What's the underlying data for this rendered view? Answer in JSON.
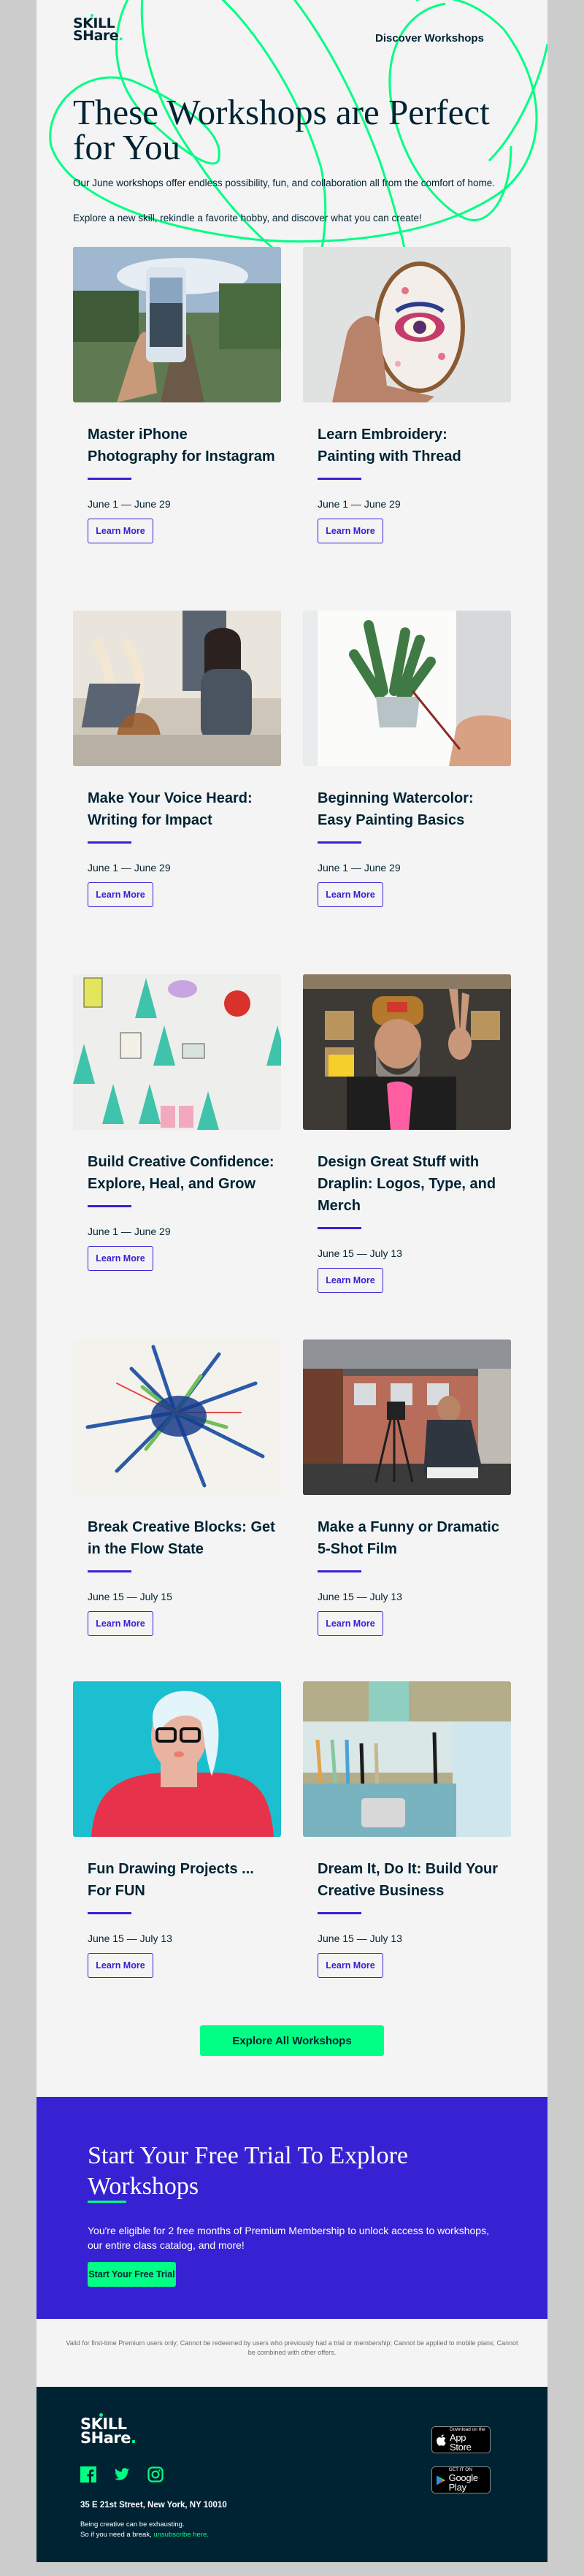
{
  "brand": {
    "logo_line1": "SKILL",
    "logo_line2": "SHare",
    "logo_dot": ".",
    "accent": "#00ff84",
    "primary": "#3722d3",
    "ink": "#002333"
  },
  "header": {
    "nav_link": "Discover Workshops"
  },
  "hero": {
    "title": "These Workshops are Perfect for You",
    "paragraph1": "Our June workshops offer endless possibility, fun, and collaboration all from the comfort of home.",
    "paragraph2": "Explore a new skill, rekindle a favorite hobby, and discover what you can create!"
  },
  "workshops": [
    {
      "title": "Master iPhone Photography for Instagram",
      "dates": "June 1 — June 29",
      "button": "Learn More",
      "image": "hand holding iPhone photographing railway tracks"
    },
    {
      "title": "Learn Embroidery: Painting with Thread",
      "dates": "June 1 — June 29",
      "button": "Learn More",
      "image": "embroidery hoop with stitched eye on floral fabric"
    },
    {
      "title": "Make Your Voice Heard: Writing for Impact",
      "dates": "June 1 — June 29",
      "button": "Learn More",
      "image": "woman writing on laptop with tea"
    },
    {
      "title": "Beginning Watercolor: Easy Painting Basics",
      "dates": "June 1 — June 29",
      "button": "Learn More",
      "image": "watercolor snake plant painting"
    },
    {
      "title": "Build Creative Confidence: Explore, Heal, and Grow",
      "dates": "June 1 — June 29",
      "button": "Learn More",
      "image": "doodled watercolor trees and labels"
    },
    {
      "title": "Design Great Stuff with Draplin: Logos, Type, and Merch",
      "dates": "June 15 — July 13",
      "button": "Learn More",
      "image": "bearded man in DDC cap giving peace sign"
    },
    {
      "title": "Break Creative Blocks: Get in the Flow State",
      "dates": "June 15 — July 15",
      "button": "Learn More",
      "image": "abstract colored pencil explosion drawing"
    },
    {
      "title": "Make a Funny or Dramatic 5-Shot Film",
      "dates": "June 15 — July 13",
      "button": "Learn More",
      "image": "man filming with camera on tripod under scaffolding"
    },
    {
      "title": "Fun Drawing Projects ... For FUN",
      "dates": "June 15 — July 13",
      "button": "Learn More",
      "image": "illustration of white-haired woman with glasses"
    },
    {
      "title": "Dream It, Do It: Build Your Creative Business",
      "dates": "June 15 — July 13",
      "button": "Learn More",
      "image": "pencil roll with art supplies and fabric"
    }
  ],
  "explore_button": "Explore All Workshops",
  "trial": {
    "title": "Start Your Free Trial To Explore Workshops",
    "paragraph": "You're eligible for 2 free months of Premium Membership to unlock access to workshops, our entire class catalog, and more!",
    "button": "Start Your Free Trial"
  },
  "disclaimer": "Valid for first-time Premium users only; Cannot be redeemed by users who previously had a trial or membership; Cannot be applied to mobile plans; Cannot be combined with other offers.",
  "footer": {
    "social": [
      "facebook-icon",
      "twitter-icon",
      "instagram-icon"
    ],
    "address": "35 E 21st Street, New York, NY 10010",
    "tagline_line1": "Being creative can be exhausting.",
    "tagline_line2": "So if you need a break, ",
    "unsubscribe_link": "unsubscribe here.",
    "app_store": {
      "small": "Download on the",
      "big": "App Store"
    },
    "google_play": {
      "small": "GET IT ON",
      "big": "Google Play"
    }
  }
}
